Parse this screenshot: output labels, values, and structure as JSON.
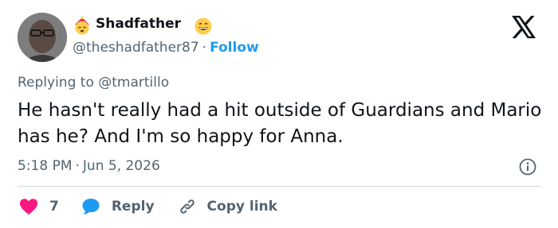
{
  "author": {
    "display_name": "Shadfather",
    "handle": "@theshadfather87",
    "separator": "·",
    "follow_label": "Follow"
  },
  "reply_context": {
    "prefix": "Replying to",
    "mention": "@tmartillo"
  },
  "tweet": {
    "text": "He hasn't really had a hit outside of Guardians and Mario has he? And I'm so happy for Anna.",
    "time": "5:18 PM",
    "separator": "·",
    "date": "Jun 5, 2026"
  },
  "actions": {
    "like_count": "7",
    "reply_label": "Reply",
    "copy_link_label": "Copy link"
  },
  "icons": {
    "brand": "x-logo",
    "info": "info-icon",
    "like": "heart-icon",
    "reply": "speech-bubble-icon",
    "copy": "link-icon",
    "emoji_left": "sleeping-face-emoji-icon",
    "emoji_right": "grinning-face-emoji-icon"
  },
  "colors": {
    "text_primary": "#0f1419",
    "text_secondary": "#536471",
    "accent": "#1d9bf0",
    "like": "#f91880",
    "divider": "#cfd9de"
  }
}
